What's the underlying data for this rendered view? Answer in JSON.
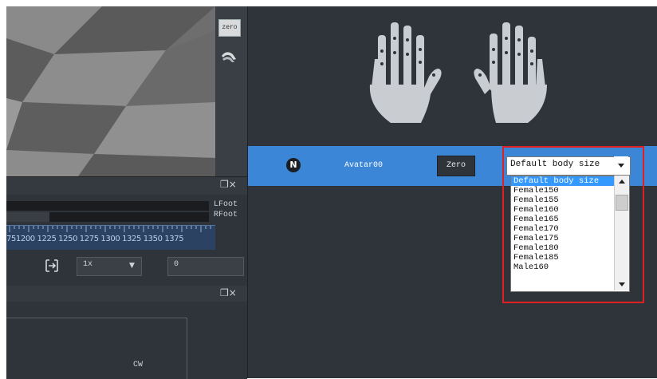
{
  "viewport": {
    "toolbar": {
      "zero_label": "zero",
      "pose_icon": "pose-icon"
    }
  },
  "timeline": {
    "dock_icons": "❐×",
    "tracks": [
      {
        "label": "LFoot"
      },
      {
        "label": "RFoot"
      }
    ],
    "ruler_text": "751200 1225 1250 1275 1300 1325 1350 1375",
    "controls": {
      "fit_icon": "fit-range-icon",
      "speed": "1x",
      "frame": "0"
    }
  },
  "bottom_panel": {
    "dock_icons": "❐×",
    "label": "CW"
  },
  "avatar_panel": {
    "row": {
      "badge": "N",
      "name": "Avatar00",
      "zero_button": "Zero",
      "body_size_selected": "Default body size"
    },
    "body_size_options": [
      "Default body size",
      "Female150",
      "Female155",
      "Female160",
      "Female165",
      "Female170",
      "Female175",
      "Female180",
      "Female185",
      "Male160"
    ],
    "colors": {
      "row_highlight": "#3b86d6",
      "panel_bg": "#2f343b",
      "selection": "#3399ff",
      "annotation_box": "#e02020"
    }
  }
}
